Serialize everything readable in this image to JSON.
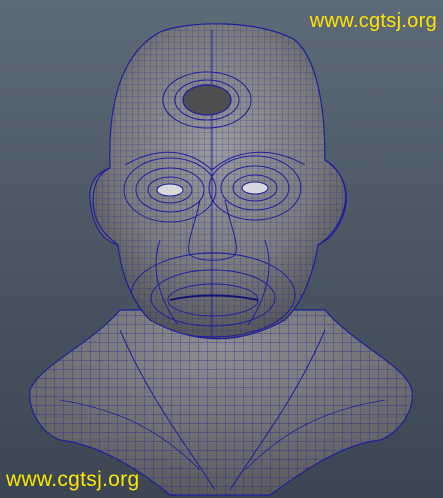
{
  "viewport": {
    "background_top": "#5d6a78",
    "background_bottom": "#3b4652",
    "mesh_fill": "#7d7d7f",
    "wireframe_color": "#1f1f9e",
    "shading_mode": "smooth-shade-with-wireframe",
    "model_subject": "sculpted head and shoulders bust"
  },
  "watermarks": {
    "top_right": "www.cgtsj.org",
    "bottom_left": "www.cgtsj.org",
    "color": "#ffe600"
  }
}
